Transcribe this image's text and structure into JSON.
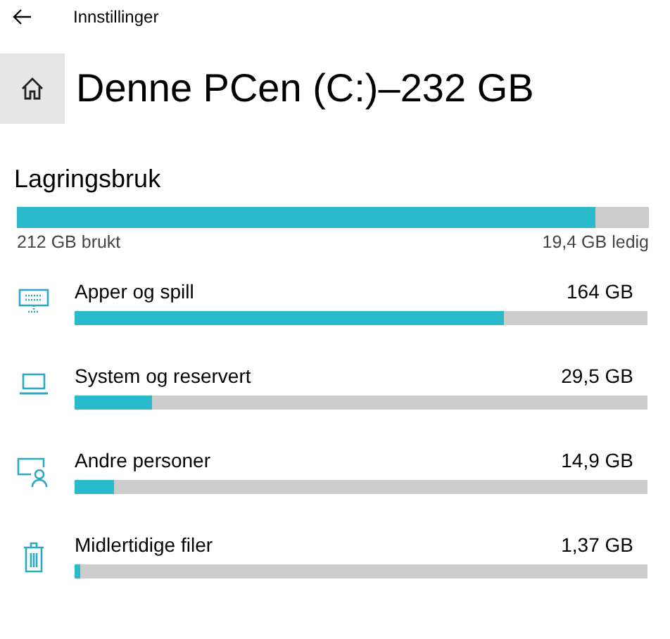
{
  "window": {
    "title": "Innstillinger"
  },
  "page": {
    "title": "Denne PCen (C:)–232 GB"
  },
  "storage": {
    "heading": "Lagringsbruk",
    "level": 0.915,
    "used": "212 GB brukt",
    "free": "19,4 GB ledig"
  },
  "categories": [
    {
      "kind": "apps",
      "name": "Apper og spill",
      "size": "164 GB",
      "level": 0.75
    },
    {
      "kind": "system",
      "name": "System og reservert",
      "size": "29,5 GB",
      "level": 0.135
    },
    {
      "kind": "users",
      "name": "Andre personer",
      "size": "14,9 GB",
      "level": 0.068
    },
    {
      "kind": "temp",
      "name": "Midlertidige filer",
      "size": "1,37 GB",
      "level": 0.01
    }
  ]
}
